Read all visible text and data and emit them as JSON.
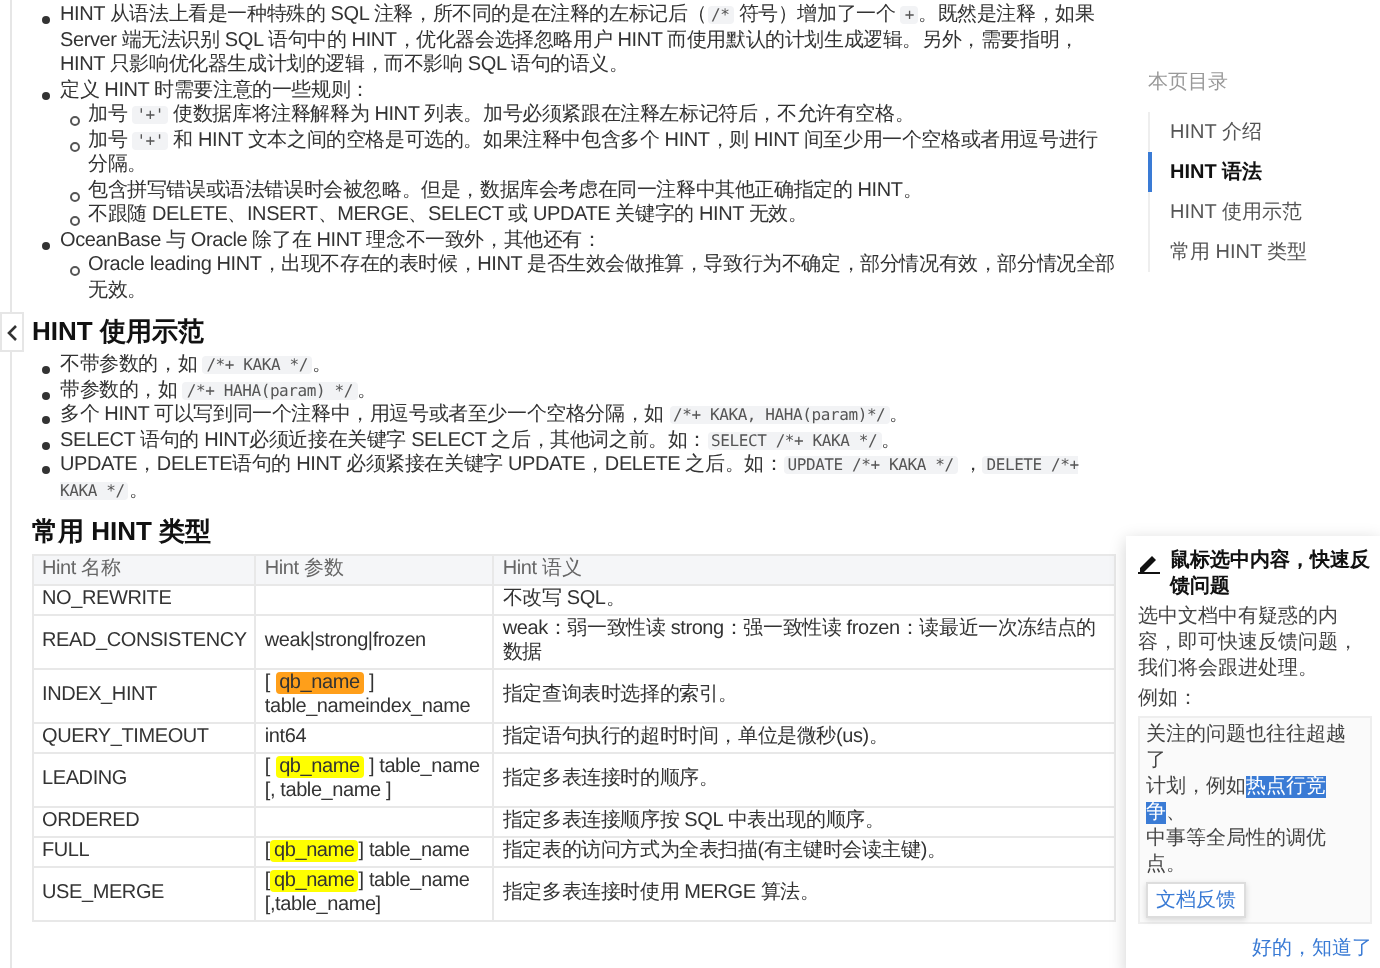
{
  "intro_bullets": [
    {
      "parts": [
        {
          "kind": "text",
          "text": "HINT 从语法上看是一种特殊的 SQL 注释，所不同的是在注释的左标记后（"
        },
        {
          "kind": "code",
          "text": "/*"
        },
        {
          "kind": "text",
          "text": " 符号）增加了一个 "
        },
        {
          "kind": "code",
          "text": "+"
        },
        {
          "kind": "text",
          "text": "。既然是注释，如果 Server 端无法识别 SQL 语句中的 HINT，优化器会选择忽略用户 HINT 而使用默认的计划生成逻辑。另外，需要指明，HINT 只影响优化器生成计划的逻辑，而不影响 SQL 语句的语义。"
        }
      ]
    },
    {
      "parts": [
        {
          "kind": "text",
          "text": "定义 HINT 时需要注意的一些规则："
        }
      ],
      "children": [
        {
          "parts": [
            {
              "kind": "text",
              "text": "加号 "
            },
            {
              "kind": "code",
              "text": "'+'"
            },
            {
              "kind": "text",
              "text": " 使数据库将注释解释为 HINT 列表。加号必须紧跟在注释左标记符后，不允许有空格。"
            }
          ]
        },
        {
          "parts": [
            {
              "kind": "text",
              "text": "加号 "
            },
            {
              "kind": "code",
              "text": "'+'"
            },
            {
              "kind": "text",
              "text": " 和 HINT 文本之间的空格是可选的。如果注释中包含多个 HINT，则 HINT 间至少用一个空格或者用逗号进行分隔。"
            }
          ]
        },
        {
          "parts": [
            {
              "kind": "text",
              "text": "包含拼写错误或语法错误时会被忽略。但是，数据库会考虑在同一注释中其他正确指定的 HINT。"
            }
          ]
        },
        {
          "parts": [
            {
              "kind": "text",
              "text": "不跟随 DELETE、INSERT、MERGE、SELECT 或 UPDATE 关键字的 HINT 无效。"
            }
          ]
        }
      ]
    },
    {
      "parts": [
        {
          "kind": "text",
          "text": "OceanBase 与 Oracle 除了在 HINT 理念不一致外，其他还有："
        }
      ],
      "children": [
        {
          "parts": [
            {
              "kind": "text",
              "text": "Oracle leading HINT，出现不存在的表时候，HINT 是否生效会做推算，导致行为不确定，部分情况有效，部分情况全部无效。"
            }
          ]
        }
      ]
    }
  ],
  "usage": {
    "heading": "HINT 使用示范",
    "bullets": [
      {
        "parts": [
          {
            "kind": "text",
            "text": "不带参数的，如 "
          },
          {
            "kind": "code",
            "text": "/*+ KAKA */"
          },
          {
            "kind": "text",
            "text": "。"
          }
        ]
      },
      {
        "parts": [
          {
            "kind": "text",
            "text": "带参数的，如 "
          },
          {
            "kind": "code",
            "text": "/*+ HAHA(param) */"
          },
          {
            "kind": "text",
            "text": "。"
          }
        ]
      },
      {
        "parts": [
          {
            "kind": "text",
            "text": "多个 HINT 可以写到同一个注释中，用逗号或者至少一个空格分隔，如 "
          },
          {
            "kind": "code",
            "text": "/*+ KAKA, HAHA(param)*/"
          },
          {
            "kind": "text",
            "text": "。"
          }
        ]
      },
      {
        "parts": [
          {
            "kind": "text",
            "text": "SELECT 语句的 HINT必须近接在关键字 SELECT 之后，其他词之前。如："
          },
          {
            "kind": "code",
            "text": "SELECT /*+ KAKA */"
          },
          {
            "kind": "text",
            "text": "。"
          }
        ]
      },
      {
        "parts": [
          {
            "kind": "text",
            "text": "UPDATE，DELETE语句的 HINT 必须紧接在关键字 UPDATE，DELETE 之后。如："
          },
          {
            "kind": "code",
            "text": "UPDATE /*+ KAKA */"
          },
          {
            "kind": "text",
            "text": " ，"
          },
          {
            "kind": "code",
            "text": "DELETE /*+ KAKA */"
          },
          {
            "kind": "text",
            "text": "。"
          }
        ]
      }
    ]
  },
  "types": {
    "heading": "常用 HINT 类型",
    "table": {
      "columns": [
        "Hint 名称",
        "Hint 参数",
        "Hint 语义"
      ],
      "rows": [
        {
          "name": "NO_REWRITE",
          "params": [],
          "meaning": "不改写 SQL。"
        },
        {
          "name": "READ_CONSISTENCY",
          "params": [
            {
              "kind": "text",
              "text": "weak|strong|frozen"
            }
          ],
          "meaning": "weak：弱一致性读 strong：强一致性读 frozen：读最近一次冻结点的数据"
        },
        {
          "name": "INDEX_HINT",
          "params": [
            {
              "kind": "text",
              "text": "[ "
            },
            {
              "kind": "mark",
              "text": "qb_name",
              "color": "#ff9f1a"
            },
            {
              "kind": "text",
              "text": " ] table_nameindex_name"
            }
          ],
          "meaning": "指定查询表时选择的索引。"
        },
        {
          "name": "QUERY_TIMEOUT",
          "params": [
            {
              "kind": "text",
              "text": "int64"
            }
          ],
          "meaning": "指定语句执行的超时时间，单位是微秒(us)。"
        },
        {
          "name": "LEADING",
          "params": [
            {
              "kind": "text",
              "text": "[ "
            },
            {
              "kind": "mark",
              "text": "qb_name",
              "color": "#ffff00"
            },
            {
              "kind": "text",
              "text": " ] table_name [, table_name ]"
            }
          ],
          "meaning": "指定多表连接时的顺序。"
        },
        {
          "name": "ORDERED",
          "params": [],
          "meaning": "指定多表连接顺序按 SQL 中表出现的顺序。"
        },
        {
          "name": "FULL",
          "params": [
            {
              "kind": "text",
              "text": "["
            },
            {
              "kind": "mark",
              "text": "qb_name",
              "color": "#ffff00"
            },
            {
              "kind": "text",
              "text": "] table_name"
            }
          ],
          "meaning": "指定表的访问方式为全表扫描(有主键时会读主键)。"
        },
        {
          "name": "USE_MERGE",
          "params": [
            {
              "kind": "text",
              "text": "["
            },
            {
              "kind": "mark",
              "text": "qb_name",
              "color": "#ffff00"
            },
            {
              "kind": "text",
              "text": "] table_name [,table_name]"
            }
          ],
          "meaning": "指定多表连接时使用 MERGE 算法。"
        }
      ]
    }
  },
  "toc": {
    "title": "本页目录",
    "items": [
      {
        "label": "HINT 介绍",
        "selected": false
      },
      {
        "label": "HINT 语法",
        "selected": true
      },
      {
        "label": "HINT 使用示范",
        "selected": false
      },
      {
        "label": "常用 HINT 类型",
        "selected": false
      }
    ]
  },
  "feedback_popup": {
    "title": "鼠标选中内容，快速反馈问题",
    "description": "选中文档中有疑惑的内容，即可快速反馈问题，我们将会跟进处理。",
    "example_label": "例如：",
    "example_lines": [
      {
        "parts": [
          {
            "kind": "text",
            "text": "关注的问题也往往超越了"
          }
        ]
      },
      {
        "parts": [
          {
            "kind": "text",
            "text": "计划，例如"
          },
          {
            "kind": "select",
            "text": "热点行竞争"
          },
          {
            "kind": "text",
            "text": "、"
          }
        ]
      },
      {
        "parts": [
          {
            "kind": "text",
            "text": "中事等全局性的调优点。"
          }
        ]
      }
    ],
    "example_button": "文档反馈",
    "confirm": "好的，知道了"
  }
}
